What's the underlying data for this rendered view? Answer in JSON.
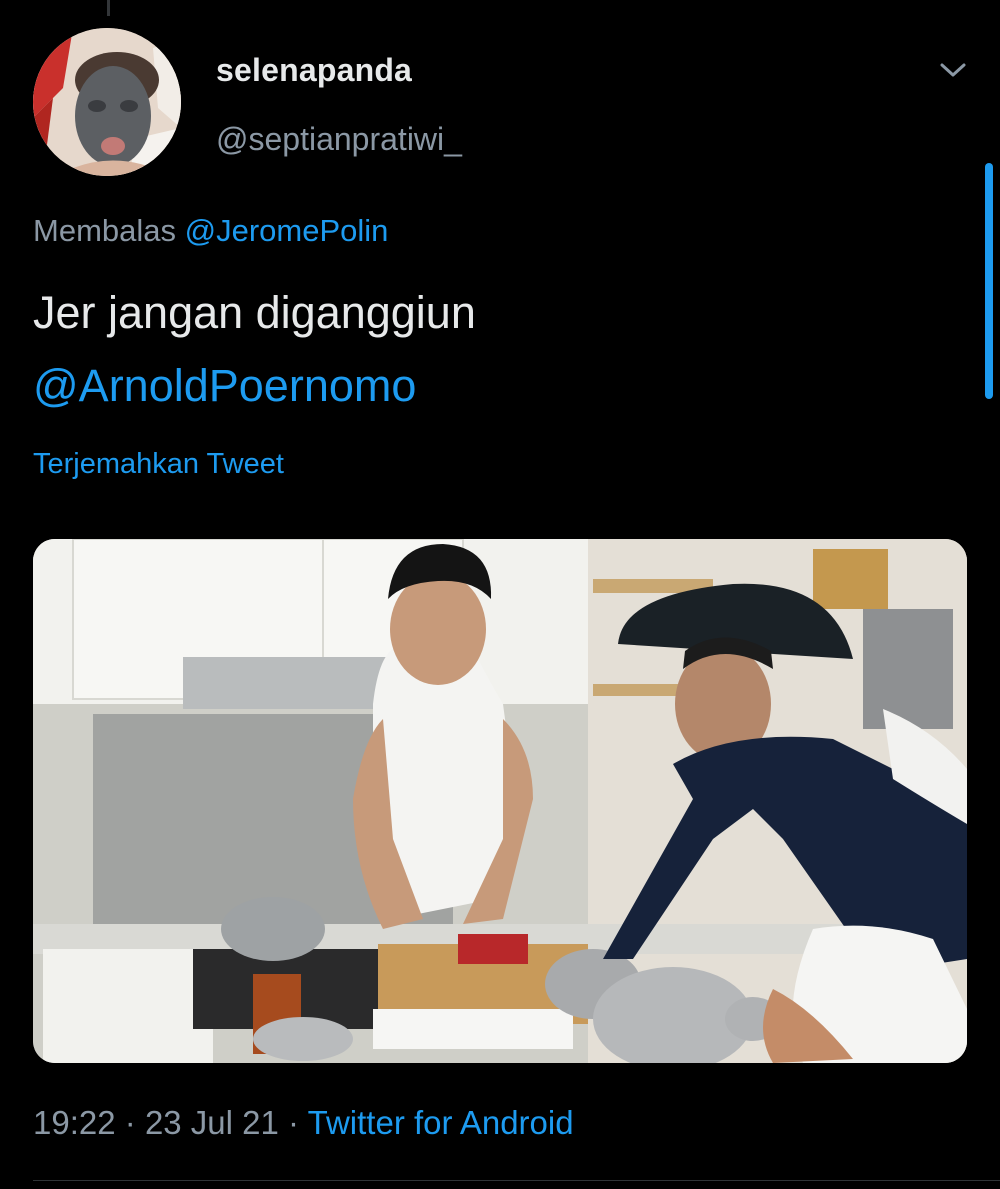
{
  "tweet": {
    "author": {
      "display_name": "selenapanda",
      "handle": "@septianpratiwi_"
    },
    "reply": {
      "prefix": "Membalas",
      "mention": "@JeromePolin"
    },
    "text": {
      "body": "Jer jangan diganggiun",
      "mention": "@ArnoldPoernomo"
    },
    "translate_label": "Terjemahkan Tweet",
    "media": {
      "icon": "photo"
    },
    "meta": {
      "time": "19:22",
      "separator": "·",
      "date": "23 Jul 21",
      "source": "Twitter for Android"
    }
  },
  "colors": {
    "background": "#000000",
    "primary_text": "#e7e9ea",
    "secondary_text": "#8b98a5",
    "accent": "#1d9bf0"
  }
}
